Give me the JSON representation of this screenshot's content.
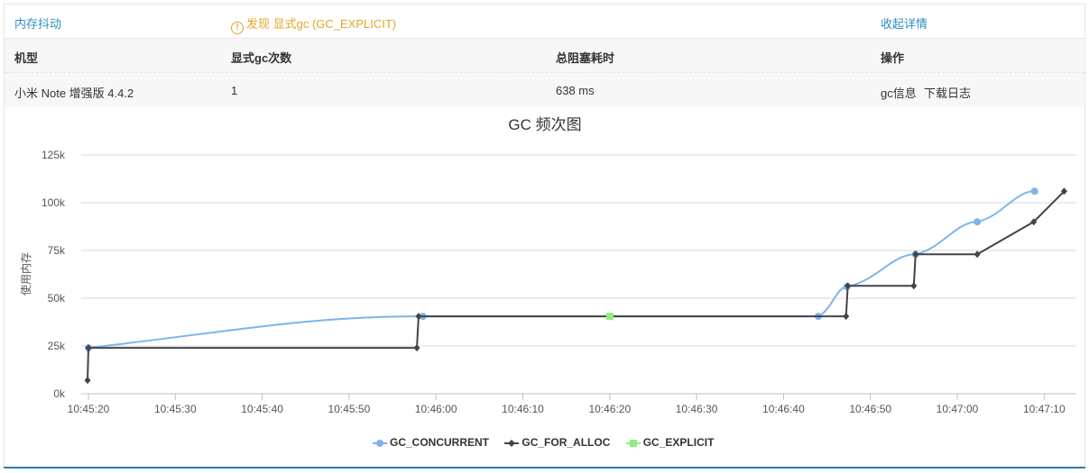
{
  "header": {
    "section_title": "内存抖动",
    "warning_text": "发现 显式gc (GC_EXPLICIT)",
    "warning_icon": "!",
    "collapse_label": "收起详情"
  },
  "table": {
    "columns": [
      "机型",
      "显式gc次数",
      "总阻塞耗时",
      "操作"
    ],
    "row": {
      "device": "小米 Note 增强版 4.4.2",
      "explicit_gc_count": "1",
      "total_block_time": "638 ms",
      "action_gc_info": "gc信息",
      "action_download_log": "下载日志"
    }
  },
  "colors": {
    "link": "#2a8fbd",
    "warning": "#e5a52a",
    "concurrent": "#7cb5ec",
    "for_alloc": "#434348",
    "explicit": "#90ed7d"
  },
  "chart_data": {
    "type": "line",
    "title": "GC 频次图",
    "ylabel": "使用内存",
    "xlabel": "",
    "ylim": [
      0,
      125000
    ],
    "y_ticks": [
      0,
      25000,
      50000,
      75000,
      100000,
      125000
    ],
    "y_tick_labels": [
      "0k",
      "25k",
      "50k",
      "75k",
      "100k",
      "125k"
    ],
    "x_ticks": [
      "10:45:20",
      "10:45:30",
      "10:45:40",
      "10:45:50",
      "10:46:00",
      "10:46:10",
      "10:46:20",
      "10:46:30",
      "10:46:40",
      "10:46:50",
      "10:47:00",
      "10:47:10"
    ],
    "grid": true,
    "legend_position": "bottom",
    "series": [
      {
        "name": "GC_CONCURRENT",
        "marker": "circle",
        "points": [
          [
            "10:45:20.0",
            24000
          ],
          [
            "10:45:58.5",
            40500
          ],
          [
            "10:46:44.0",
            40500
          ],
          [
            "10:46:47.3",
            56000
          ],
          [
            "10:46:55.2",
            73000
          ],
          [
            "10:47:02.3",
            90000
          ],
          [
            "10:47:08.9",
            106000
          ]
        ]
      },
      {
        "name": "GC_FOR_ALLOC",
        "marker": "diamond",
        "points": [
          [
            "10:45:19.9",
            7000
          ],
          [
            "10:45:20.0",
            24000
          ],
          [
            "10:45:57.8",
            24000
          ],
          [
            "10:45:58.0",
            40500
          ],
          [
            "10:46:47.2",
            40500
          ],
          [
            "10:46:47.4",
            56500
          ],
          [
            "10:46:55.0",
            56500
          ],
          [
            "10:46:55.2",
            73000
          ],
          [
            "10:47:02.3",
            73000
          ],
          [
            "10:47:08.8",
            90000
          ],
          [
            "10:47:12.3",
            106000
          ]
        ]
      },
      {
        "name": "GC_EXPLICIT",
        "marker": "square",
        "points": [
          [
            "10:46:20.0",
            40500
          ]
        ]
      }
    ]
  }
}
